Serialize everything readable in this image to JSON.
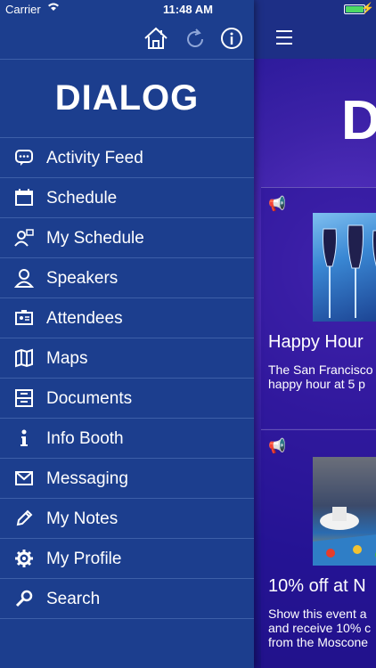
{
  "status_bar": {
    "carrier": "Carrier",
    "time": "11:48 AM",
    "battery_level": 1.0
  },
  "brand": {
    "name": "DIALOG"
  },
  "header": {
    "partial_logo": "D"
  },
  "sidebar": {
    "items": [
      {
        "label": "Activity Feed",
        "icon": "chat-bubble-icon"
      },
      {
        "label": "Schedule",
        "icon": "calendar-icon"
      },
      {
        "label": "My Schedule",
        "icon": "person-calendar-icon"
      },
      {
        "label": "Speakers",
        "icon": "speaker-person-icon"
      },
      {
        "label": "Attendees",
        "icon": "id-card-icon"
      },
      {
        "label": "Maps",
        "icon": "map-icon"
      },
      {
        "label": "Documents",
        "icon": "document-box-icon"
      },
      {
        "label": "Info Booth",
        "icon": "info-icon"
      },
      {
        "label": "Messaging",
        "icon": "envelope-icon"
      },
      {
        "label": "My Notes",
        "icon": "pencil-icon"
      },
      {
        "label": "My Profile",
        "icon": "gear-icon"
      },
      {
        "label": "Search",
        "icon": "search-icon"
      }
    ]
  },
  "feed": {
    "cards": [
      {
        "title": "Happy Hour",
        "desc_line1": "The San Francisco",
        "desc_line2": "happy hour at 5 p",
        "desc_line3": ""
      },
      {
        "title": "10% off at N",
        "desc_line1": "Show this event a",
        "desc_line2": "and receive 10% c",
        "desc_line3": "from the Moscone"
      }
    ]
  },
  "colors": {
    "sidebar_bg": "#1c3e8e",
    "accent_green": "#4cd964",
    "content_purple": "#3d22a8"
  }
}
